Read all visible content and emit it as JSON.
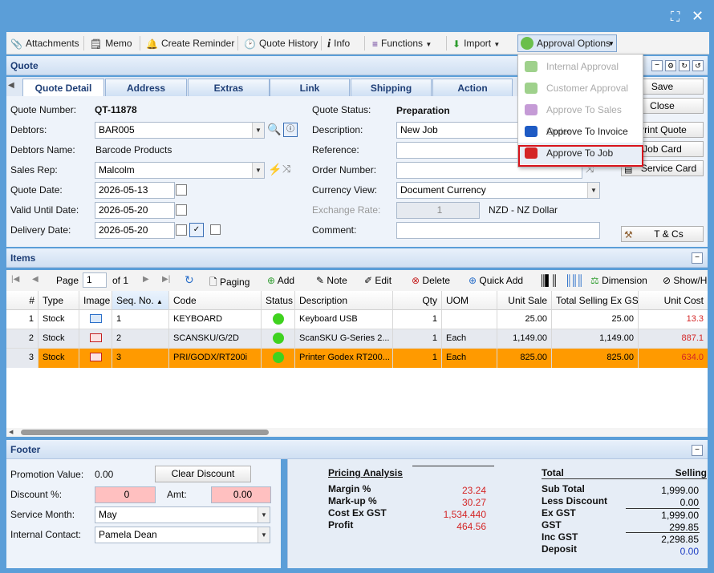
{
  "toolbar": {
    "attachments": "Attachments",
    "memo": "Memo",
    "create_reminder": "Create Reminder",
    "quote_history": "Quote History",
    "info": "Info",
    "functions": "Functions",
    "import": "Import",
    "approval_options": "Approval Options"
  },
  "approval_menu": {
    "items": [
      {
        "label": "Internal Approval",
        "enabled": false,
        "color": "#9fd18c"
      },
      {
        "label": "Customer Approval",
        "enabled": false,
        "color": "#9fd18c"
      },
      {
        "label": "Approve To Sales Order",
        "enabled": false,
        "color": "#c59bd6"
      },
      {
        "label": "Approve To Invoice",
        "enabled": true,
        "color": "#1e5bc4"
      },
      {
        "label": "Approve To Job",
        "enabled": true,
        "color": "#d42525"
      }
    ]
  },
  "quote": {
    "section_title": "Quote",
    "tabs": [
      "Quote Detail",
      "Address",
      "Extras",
      "Link",
      "Shipping",
      "Action"
    ],
    "labels": {
      "quote_number": "Quote Number:",
      "debtors": "Debtors:",
      "debtors_name": "Debtors Name:",
      "sales_rep": "Sales Rep:",
      "quote_date": "Quote Date:",
      "valid_until": "Valid Until Date:",
      "delivery_date": "Delivery Date:",
      "quote_status": "Quote Status:",
      "description": "Description:",
      "reference": "Reference:",
      "order_number": "Order Number:",
      "currency_view": "Currency View:",
      "exchange_rate": "Exchange Rate:",
      "comment": "Comment:"
    },
    "values": {
      "quote_number": "QT-11878",
      "debtors": "BAR005",
      "debtors_name": "Barcode Products",
      "sales_rep": "Malcolm",
      "quote_date": "2026-05-13",
      "valid_until": "2026-05-20",
      "delivery_date": "2026-05-20",
      "quote_status": "Preparation",
      "description": "New Job",
      "reference": "",
      "order_number": "",
      "currency_view": "Document Currency",
      "exchange_rate": "1",
      "currency_name": "NZD - NZ Dollar",
      "comment": ""
    },
    "buttons": {
      "save": "Save",
      "close": "Close",
      "print_quote": "Print Quote",
      "job_card": "Job Card",
      "service_card": "Service Card",
      "tcs": "T & Cs"
    }
  },
  "items": {
    "section_title": "Items",
    "pager": {
      "page_label": "Page",
      "page": "1",
      "of": "of 1",
      "paging": "Paging"
    },
    "actions": {
      "add": "Add",
      "note": "Note",
      "edit": "Edit",
      "delete": "Delete",
      "quick_add": "Quick Add",
      "dimension": "Dimension",
      "show": "Show/H"
    },
    "columns": [
      "#",
      "Type",
      "Image",
      "Seq. No.",
      "Code",
      "Status",
      "Description",
      "Qty",
      "UOM",
      "Unit Sale",
      "Total Selling Ex GST",
      "Unit Cost"
    ],
    "rows": [
      {
        "n": "1",
        "type": "Stock",
        "seq": "1",
        "code": "KEYBOARD",
        "desc": "Keyboard USB",
        "qty": "1",
        "uom": "",
        "unit_sale": "25.00",
        "total": "25.00",
        "unit_cost": "13.3"
      },
      {
        "n": "2",
        "type": "Stock",
        "seq": "2",
        "code": "SCANSKU/G/2D",
        "desc": "ScanSKU G-Series 2...",
        "qty": "1",
        "uom": "Each",
        "unit_sale": "1,149.00",
        "total": "1,149.00",
        "unit_cost": "887.1"
      },
      {
        "n": "3",
        "type": "Stock",
        "seq": "3",
        "code": "PRI/GODX/RT200i",
        "desc": "Printer Godex RT200...",
        "qty": "1",
        "uom": "Each",
        "unit_sale": "825.00",
        "total": "825.00",
        "unit_cost": "634.0"
      }
    ]
  },
  "footer": {
    "section_title": "Footer",
    "promotion_value_label": "Promotion Value:",
    "promotion_value": "0.00",
    "clear_discount": "Clear Discount",
    "discount_label": "Discount %:",
    "discount": "0",
    "amt_label": "Amt:",
    "amt": "0.00",
    "service_month_label": "Service Month:",
    "service_month": "May",
    "internal_contact_label": "Internal Contact:",
    "internal_contact": "Pamela Dean",
    "pricing": {
      "title": "Pricing Analysis",
      "margin_label": "Margin %",
      "margin": "23.24",
      "markup_label": "Mark-up %",
      "markup": "30.27",
      "cost_label": "Cost Ex GST",
      "cost": "1,534.440",
      "profit_label": "Profit",
      "profit": "464.56"
    },
    "totals": {
      "total_label": "Total",
      "selling_label": "Selling",
      "subtotal_label": "Sub Total",
      "subtotal": "1,999.00",
      "less_discount_label": "Less Discount",
      "less_discount": "0.00",
      "ex_gst_label": "Ex GST",
      "ex_gst": "1,999.00",
      "gst_label": "GST",
      "gst": "299.85",
      "inc_gst_label": "Inc GST",
      "inc_gst": "2,298.85",
      "deposit_label": "Deposit",
      "deposit": "0.00"
    }
  }
}
